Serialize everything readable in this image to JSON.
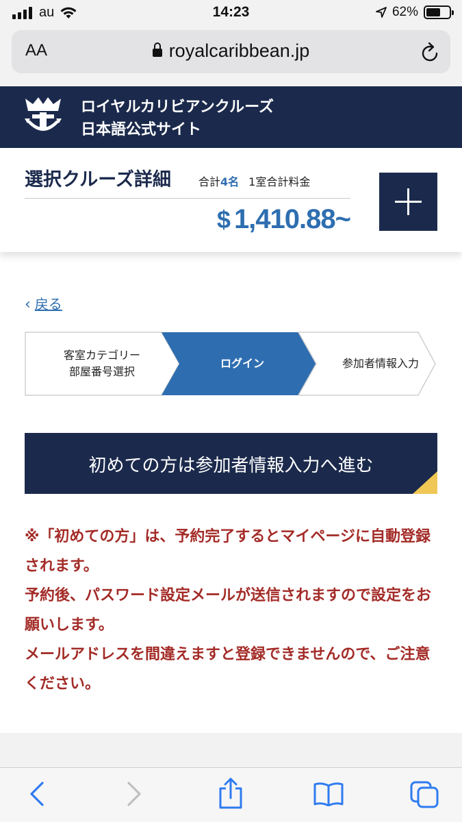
{
  "status_bar": {
    "carrier": "au",
    "time": "14:23",
    "battery_percent": "62%",
    "battery_level": 0.62
  },
  "browser": {
    "aa_label": "AA",
    "url": "royalcaribbean.jp"
  },
  "site": {
    "title_line1": "ロイヤルカリビアンクルーズ",
    "title_line2": "日本語公式サイト",
    "brand_color": "#1b2a4c"
  },
  "cruise_detail": {
    "title": "選択クルーズ詳細",
    "guests_prefix": "合計",
    "guests_count": "4名",
    "room_label": "1室合計料金",
    "currency": "$",
    "price": "1,410.88~",
    "accent_color": "#2e6eb0"
  },
  "nav": {
    "back_label": "戻る"
  },
  "steps": [
    {
      "line1": "客室カテゴリー",
      "line2": "部屋番号選択",
      "active": false
    },
    {
      "line1": "ログイン",
      "line2": "",
      "active": true
    },
    {
      "line1": "参加者情報入力",
      "line2": "",
      "active": false
    }
  ],
  "cta": {
    "label": "初めての方は参加者情報入力へ進む"
  },
  "notes": [
    "※「初めての方」は、予約完了するとマイページに自動登録されます。",
    "予約後、パスワード設定メールが送信されますので設定をお願いします。",
    "メールアドレスを間違えますと登録できませんので、ご注意ください。"
  ],
  "toolbar": {
    "icons": [
      "back-icon",
      "forward-icon",
      "share-icon",
      "bookmarks-icon",
      "tabs-icon"
    ]
  }
}
